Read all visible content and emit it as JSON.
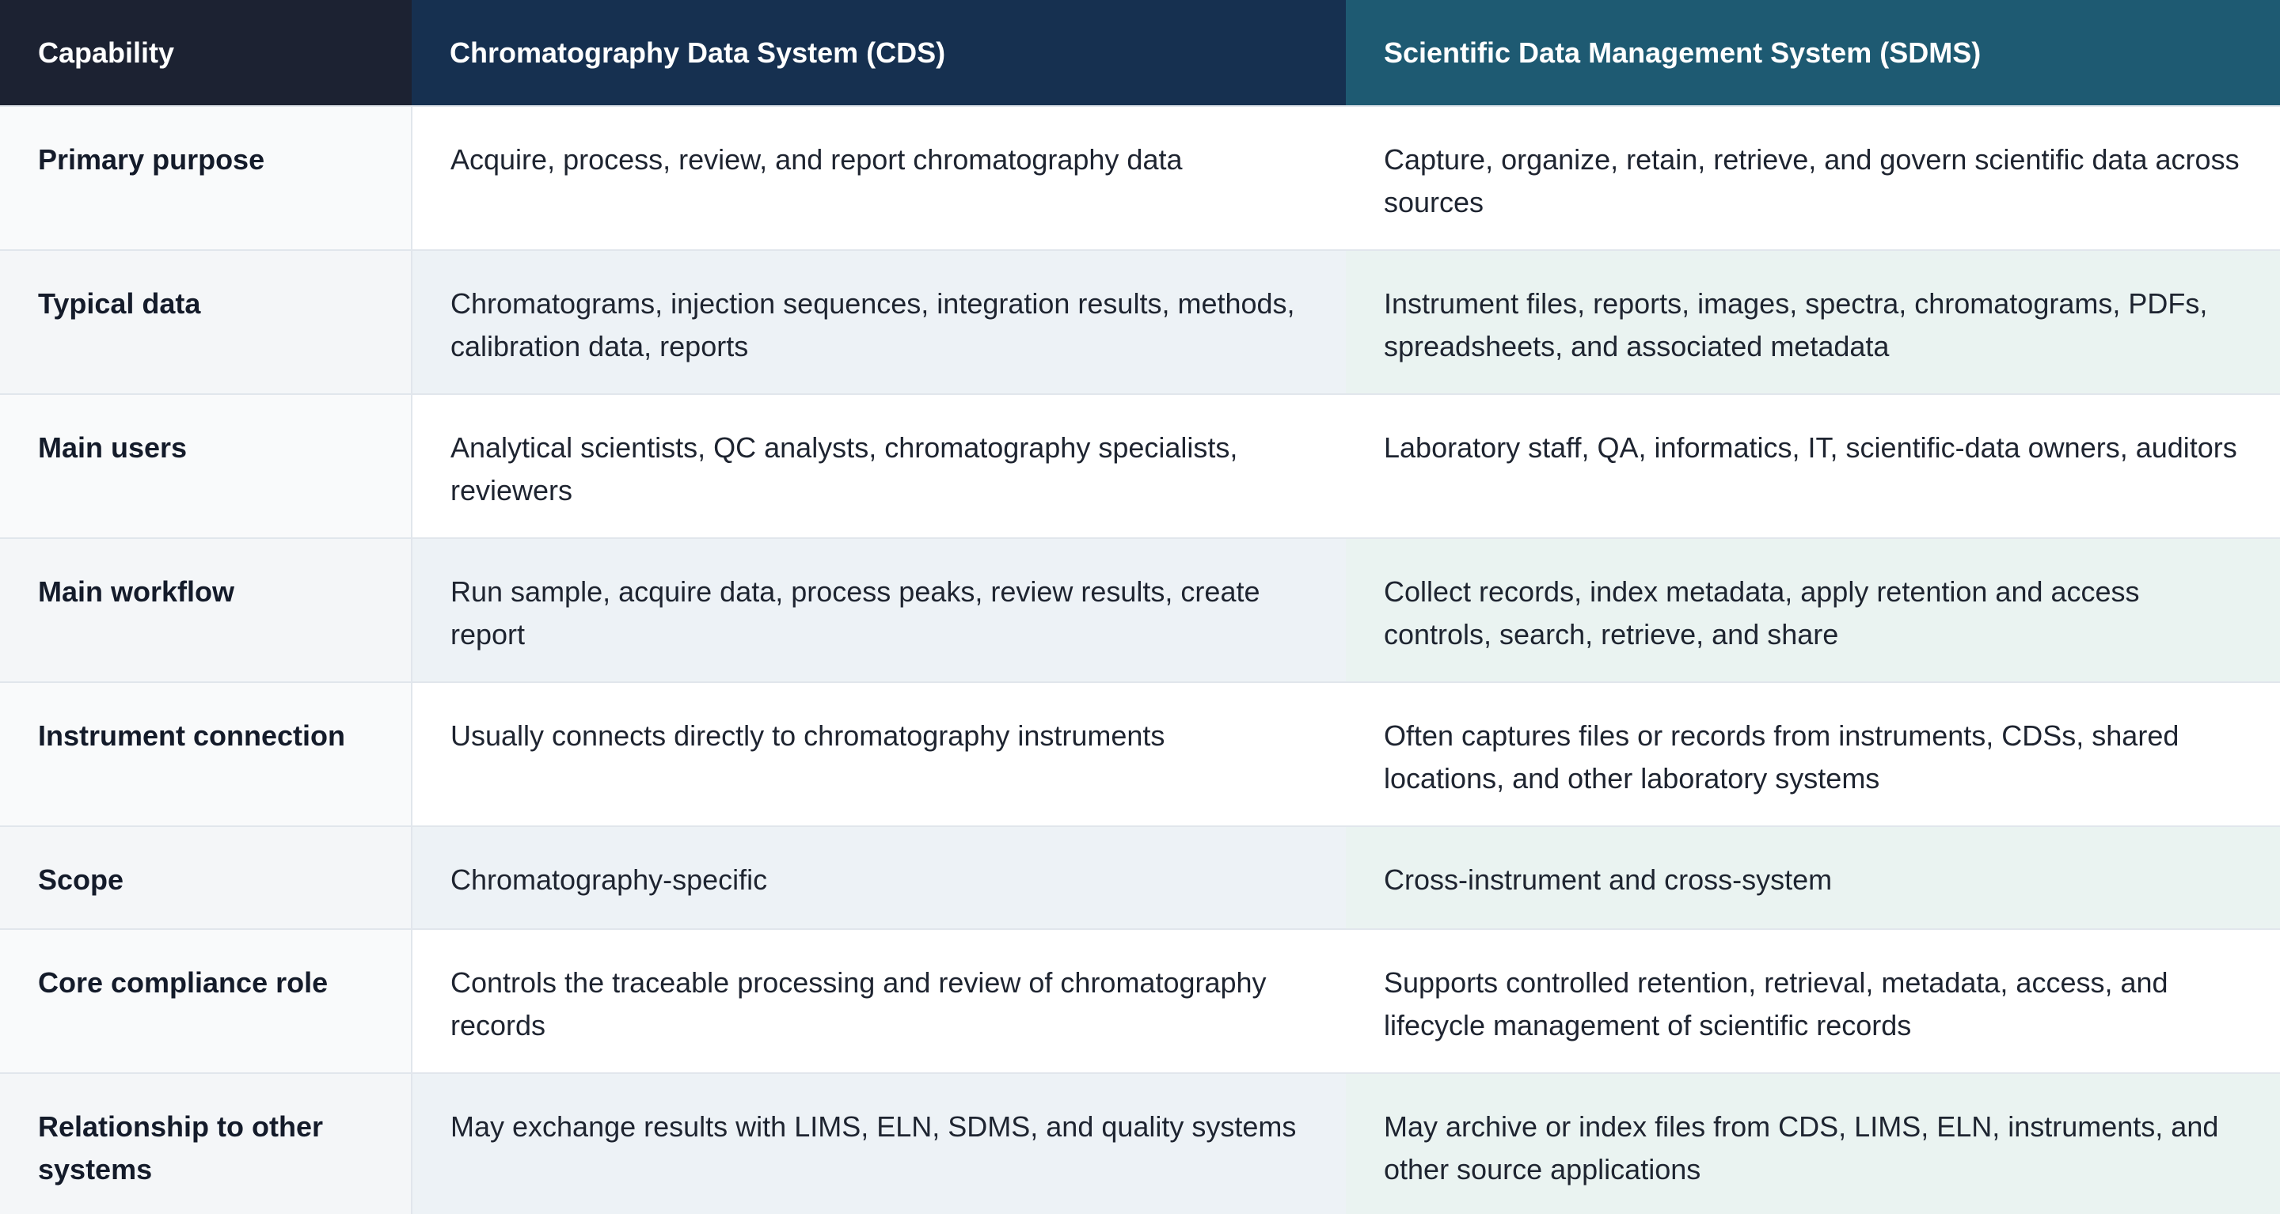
{
  "header": {
    "capability": "Capability",
    "cds": "Chromatography Data System (CDS)",
    "sdms": "Scientific Data Management System (SDMS)"
  },
  "rows": [
    {
      "capability": "Primary purpose",
      "cds": "Acquire, process, review, and report chromatography data",
      "sdms": "Capture, organize, retain, retrieve, and govern scientific data across sources"
    },
    {
      "capability": "Typical data",
      "cds": "Chromatograms, injection sequences, integration results, methods, calibration data, reports",
      "sdms": "Instrument files, reports, images, spectra, chromatograms, PDFs, spreadsheets, and associated metadata"
    },
    {
      "capability": "Main users",
      "cds": "Analytical scientists, QC analysts, chromatography specialists, reviewers",
      "sdms": "Laboratory staff, QA, informatics, IT, scientific-data owners, auditors"
    },
    {
      "capability": "Main workflow",
      "cds": "Run sample, acquire data, process peaks, review results, create report",
      "sdms": "Collect records, index metadata, apply retention and access controls, search, retrieve, and share"
    },
    {
      "capability": "Instrument connection",
      "cds": "Usually connects directly to chromatography instruments",
      "sdms": "Often captures files or records from instruments, CDSs, shared locations, and other laboratory systems"
    },
    {
      "capability": "Scope",
      "cds": "Chromatography-specific",
      "sdms": "Cross-instrument and cross-system"
    },
    {
      "capability": "Core compliance role",
      "cds": "Controls the traceable processing and review of chromatography records",
      "sdms": "Supports controlled retention, retrieval, metadata, access, and lifecycle management of scientific records"
    },
    {
      "capability": "Relationship to other systems",
      "cds": "May exchange results with LIMS, ELN, SDMS, and quality systems",
      "sdms": "May archive or index files from CDS, LIMS, ELN, instruments, and other source applications"
    }
  ]
}
